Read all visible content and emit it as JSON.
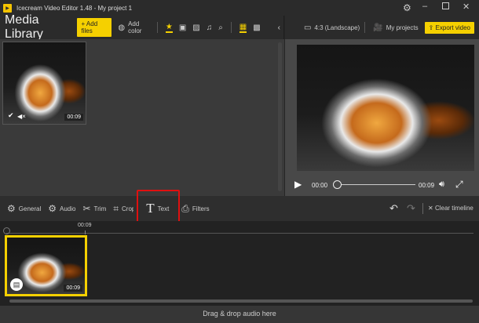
{
  "app": {
    "title": "Icecream Video Editor 1.48  -  My project 1"
  },
  "toolbar": {
    "media_library": "Media Library",
    "add_files": "+ Add files",
    "add_color": "Add color",
    "aspect": "4:3 (Landscape)",
    "my_projects": "My projects",
    "export": "Export video"
  },
  "media": {
    "items": [
      {
        "duration": "00:09"
      }
    ]
  },
  "player": {
    "current": "00:00",
    "total": "00:09",
    "progress": 0
  },
  "edit": {
    "items": [
      {
        "label": "General",
        "icon": "gear-icon"
      },
      {
        "label": "Audio",
        "icon": "gear-icon"
      },
      {
        "label": "Trim",
        "icon": "scissors-icon"
      },
      {
        "label": "Crop",
        "icon": "crop-icon"
      },
      {
        "label": "Text",
        "icon": "text-icon"
      },
      {
        "label": "Filters",
        "icon": "filters-icon"
      }
    ],
    "clear": "Clear timeline"
  },
  "timeline": {
    "marker": "00:09",
    "clip_duration": "00:09",
    "drop_audio": "Drag & drop audio here"
  },
  "colors": {
    "accent": "#f5d000",
    "highlight": "#e01010"
  }
}
